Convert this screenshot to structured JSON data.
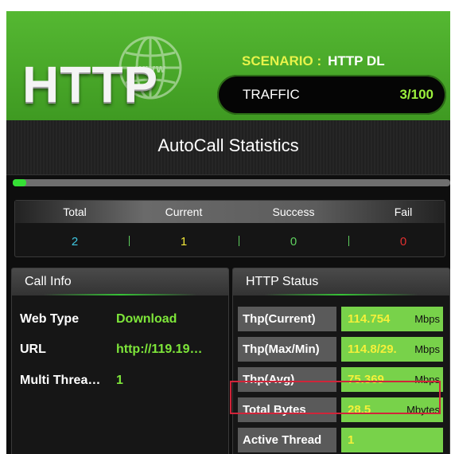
{
  "header": {
    "logo": "HTTP",
    "globe_icon": "globe-www-icon",
    "scenario_label": "SCENARIO :",
    "scenario_value": "HTTP DL",
    "traffic_label": "TRAFFIC",
    "traffic_value": "3/100"
  },
  "title": "AutoCall Statistics",
  "progress": {
    "fraction": 0.03
  },
  "stats": {
    "headers": [
      "Total",
      "Current",
      "Success",
      "Fail"
    ],
    "values": [
      "2",
      "1",
      "0",
      "0"
    ],
    "colors": [
      "#3fc6e0",
      "#f0e63a",
      "#5fd05f",
      "#e03030"
    ]
  },
  "call_info": {
    "title": "Call Info",
    "rows": [
      {
        "key": "Web Type",
        "value": "Download"
      },
      {
        "key": "URL",
        "value": "http://119.19…"
      },
      {
        "key": "Multi Threa…",
        "value": "1"
      }
    ]
  },
  "http_status": {
    "title": "HTTP Status",
    "rows": [
      {
        "label": "Thp(Current)",
        "value": "114.754",
        "unit": "Mbps"
      },
      {
        "label": "Thp(Max/Min)",
        "value": "114.8/29.",
        "unit": "Mbps"
      },
      {
        "label": "Thp(Avg)",
        "value": "75.369",
        "unit": "Mbps"
      },
      {
        "label": "Total Bytes",
        "value": "28.5",
        "unit": "Mbytes"
      },
      {
        "label": "Active Thread",
        "value": "1",
        "unit": ""
      }
    ]
  }
}
